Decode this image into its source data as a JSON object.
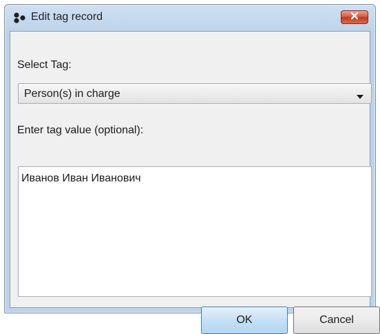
{
  "window": {
    "title": "Edit tag record",
    "icon": "tags-icon",
    "close_icon": "close-icon",
    "close_color": "#c4371b"
  },
  "form": {
    "select_label": "Select Tag:",
    "selected_tag": "Person(s) in charge",
    "value_label": "Enter tag value (optional):",
    "value_text": "Иванов Иван Иванович"
  },
  "buttons": {
    "ok_label": "OK",
    "cancel_label": "Cancel"
  }
}
